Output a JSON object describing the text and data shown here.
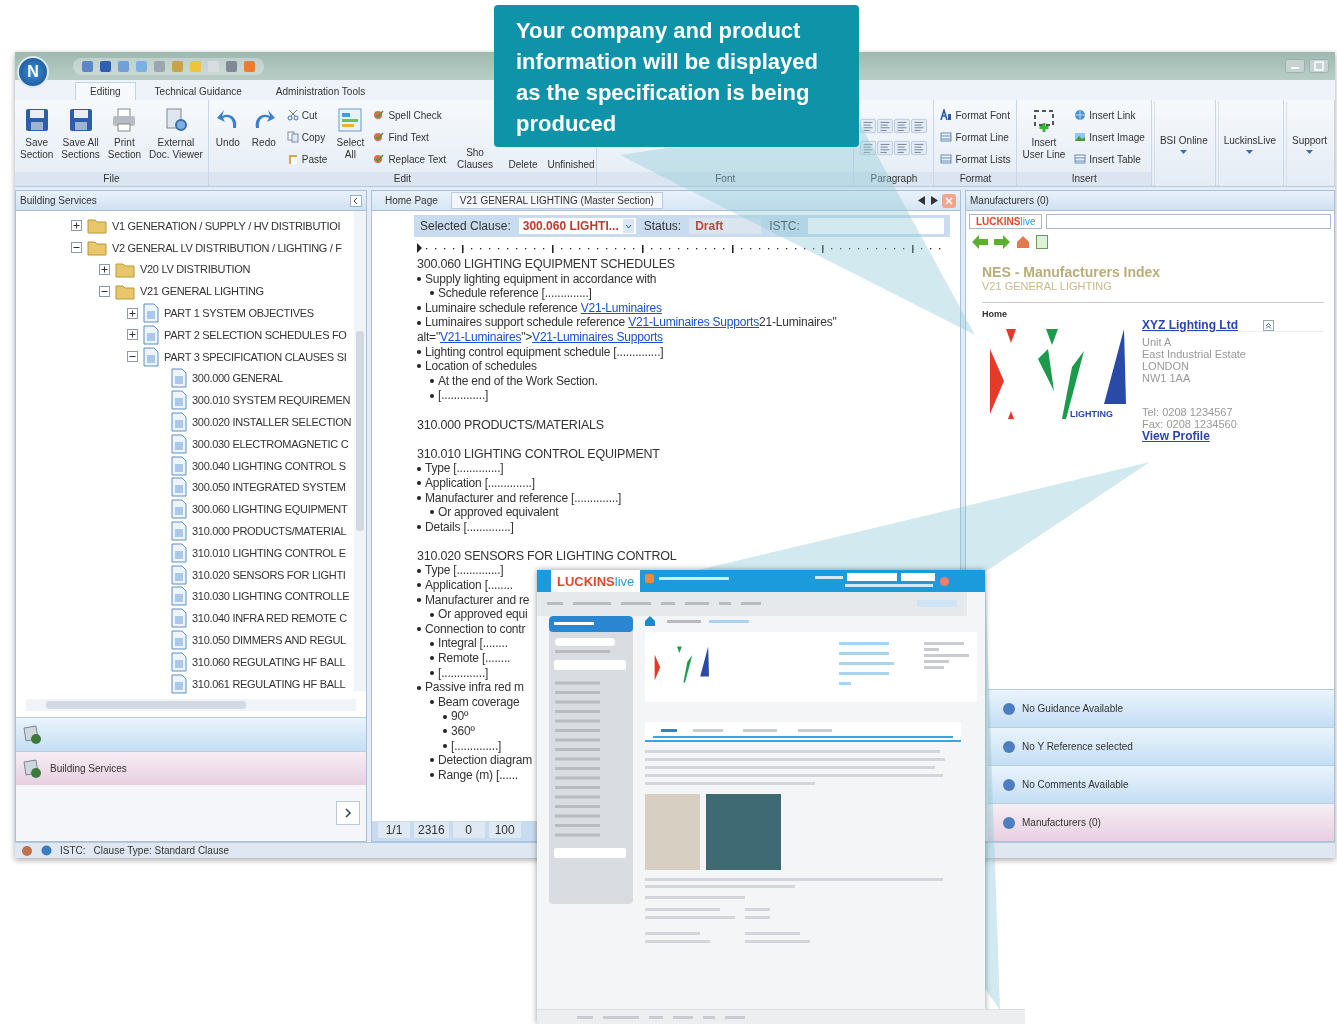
{
  "callout": {
    "text": "Your company and product information will be displayed as the specification is being produced"
  },
  "app": {
    "logo_letter": "N"
  },
  "ribbon_tabs": [
    {
      "label": "Editing",
      "selected": true
    },
    {
      "label": "Technical Guidance",
      "selected": false
    },
    {
      "label": "Administration Tools",
      "selected": false
    }
  ],
  "ribbon_groups": [
    {
      "title": "File",
      "items": [
        {
          "kind": "large",
          "lines": [
            "Save",
            "Section"
          ]
        },
        {
          "kind": "large",
          "lines": [
            "Save All",
            "Sections"
          ]
        },
        {
          "kind": "large",
          "lines": [
            "Print",
            "Section"
          ]
        },
        {
          "kind": "large",
          "lines": [
            "External",
            "Doc. Viewer"
          ]
        }
      ]
    },
    {
      "title": "Edit",
      "items": [
        {
          "kind": "large",
          "lines": [
            "Undo"
          ]
        },
        {
          "kind": "large",
          "lines": [
            "Redo"
          ]
        },
        {
          "kind": "stack",
          "items": [
            {
              "label": "Cut"
            },
            {
              "label": "Copy"
            },
            {
              "label": "Paste"
            }
          ]
        },
        {
          "kind": "large",
          "lines": [
            "Select",
            "All"
          ]
        },
        {
          "kind": "stack",
          "items": [
            {
              "label": "Spell Check"
            },
            {
              "label": "Find Text"
            },
            {
              "label": "Replace Text"
            }
          ]
        },
        {
          "kind": "hidden",
          "lines": [
            "Sho",
            "Clauses"
          ]
        },
        {
          "kind": "hidden",
          "lines": [
            "Delete"
          ]
        },
        {
          "kind": "hidden",
          "lines": [
            "Unfinished"
          ]
        }
      ]
    },
    {
      "title": "Font"
    },
    {
      "title": "Paragraph",
      "items": [
        {
          "kind": "align_grid"
        }
      ]
    },
    {
      "title": "Format",
      "items": [
        {
          "kind": "stack",
          "items": [
            {
              "label": "Format Font"
            },
            {
              "label": "Format Line"
            },
            {
              "label": "Format Lists"
            }
          ]
        }
      ]
    },
    {
      "title": "Insert",
      "items": [
        {
          "kind": "large",
          "lines": [
            "Insert",
            "User Line"
          ]
        },
        {
          "kind": "stack",
          "items": [
            {
              "label": "Insert Link"
            },
            {
              "label": "Insert Image"
            },
            {
              "label": "Insert Table"
            }
          ]
        }
      ]
    },
    {
      "items": [
        {
          "kind": "dropdown",
          "lines": [
            "BSI Online"
          ]
        }
      ]
    },
    {
      "items": [
        {
          "kind": "dropdown",
          "lines": [
            "LuckinsLive"
          ]
        }
      ]
    },
    {
      "items": [
        {
          "kind": "dropdown",
          "lines": [
            "Support"
          ]
        }
      ]
    }
  ],
  "left_panel": {
    "title": "Building Services",
    "tree": [
      {
        "kind": "folder",
        "label": "V1 GENERATION / SUPPLY / HV DISTRIBUTIOI",
        "expanded": false
      },
      {
        "kind": "folder",
        "label": "V2 GENERAL LV DISTRIBUTION / LIGHTING / F",
        "expanded": true,
        "children": [
          {
            "kind": "folder",
            "label": "V20 LV DISTRIBUTION",
            "expanded": false
          },
          {
            "kind": "folder",
            "label": "V21 GENERAL LIGHTING",
            "expanded": true,
            "children": [
              {
                "kind": "document",
                "label": "PART 1 SYSTEM OBJECTIVES",
                "expanded": false
              },
              {
                "kind": "document",
                "label": "PART 2 SELECTION SCHEDULES FO",
                "expanded": false
              },
              {
                "kind": "document",
                "label": "PART 3 SPECIFICATION CLAUSES SI",
                "expanded": true,
                "children": [
                  {
                    "kind": "clause",
                    "label": "300.000 GENERAL"
                  },
                  {
                    "kind": "clause",
                    "label": "300.010 SYSTEM REQUIREMEN"
                  },
                  {
                    "kind": "clause",
                    "label": "300.020 INSTALLER SELECTION"
                  },
                  {
                    "kind": "clause",
                    "label": "300.030 ELECTROMAGNETIC C"
                  },
                  {
                    "kind": "clause",
                    "label": "300.040 LIGHTING CONTROL S"
                  },
                  {
                    "kind": "clause",
                    "label": "300.050 INTEGRATED SYSTEM"
                  },
                  {
                    "kind": "clause",
                    "label": "300.060 LIGHTING EQUIPMENT"
                  },
                  {
                    "kind": "clause",
                    "label": "310.000 PRODUCTS/MATERIAL"
                  },
                  {
                    "kind": "clause",
                    "label": "310.010 LIGHTING CONTROL E"
                  },
                  {
                    "kind": "clause",
                    "label": "310.020 SENSORS FOR LIGHTI"
                  },
                  {
                    "kind": "clause",
                    "label": "310.030 LIGHTING CONTROLLE"
                  },
                  {
                    "kind": "clause",
                    "label": "310.040 INFRA RED REMOTE C"
                  },
                  {
                    "kind": "clause",
                    "label": "310.050 DIMMERS AND REGUL"
                  },
                  {
                    "kind": "clause",
                    "label": "310.060 REGULATING HF BALL"
                  },
                  {
                    "kind": "clause",
                    "label": "310.061 REGULATING HF BALL"
                  }
                ]
              }
            ]
          }
        ]
      }
    ],
    "nav_buttons": [
      {
        "selected": false
      },
      {
        "label": "Building Services",
        "selected": true
      }
    ]
  },
  "document": {
    "tabs": [
      {
        "label": "Home Page",
        "selected": false
      },
      {
        "label": "V21 GENERAL LIGHTING (Master Section)",
        "selected": true
      }
    ],
    "selected_clause_label": "Selected Clause:",
    "selected_clause": "300.060 LIGHTI...",
    "status_label": "Status:",
    "status": "Draft",
    "istc_label": "ISTC:",
    "lines": [
      {
        "kind": "heading",
        "text": "300.060 LIGHTING EQUIPMENT SCHEDULES"
      },
      {
        "kind": "bullet",
        "text": "Supply lighting equipment in accordance with"
      },
      {
        "kind": "sub_bullet",
        "text": "Schedule reference [..............]"
      },
      {
        "kind": "bullet",
        "segments": [
          {
            "kind": "text",
            "text": "Luminaire schedule reference "
          },
          {
            "kind": "link",
            "text": "V21-Luminaires"
          }
        ]
      },
      {
        "kind": "bullet",
        "segments": [
          {
            "kind": "text",
            "text": "Luminaires support schedule reference "
          },
          {
            "kind": "link",
            "text": "V21-Luminaires Supports"
          },
          {
            "kind": "text",
            "text": "21-Luminaires\""
          }
        ]
      },
      {
        "kind": "cont",
        "segments": [
          {
            "kind": "text",
            "text": "alt=\""
          },
          {
            "kind": "link",
            "text": "V21-Luminaires"
          },
          {
            "kind": "text",
            "text": "\">"
          },
          {
            "kind": "link",
            "text": "V21-Luminaires Supports"
          }
        ]
      },
      {
        "kind": "bullet",
        "text": "Lighting control equipment schedule [..............]"
      },
      {
        "kind": "bullet",
        "text": "Location of schedules"
      },
      {
        "kind": "sub_bullet",
        "text": "At the end of the Work Section."
      },
      {
        "kind": "sub_bullet",
        "text": "[..............]"
      },
      {
        "kind": "blank"
      },
      {
        "kind": "heading",
        "text": "310.000 PRODUCTS/MATERIALS"
      },
      {
        "kind": "blank"
      },
      {
        "kind": "heading",
        "text": "310.010 LIGHTING CONTROL EQUIPMENT"
      },
      {
        "kind": "bullet",
        "text": "Type [..............]"
      },
      {
        "kind": "bullet",
        "text": "Application [..............]"
      },
      {
        "kind": "bullet",
        "text": "Manufacturer and reference [..............]"
      },
      {
        "kind": "sub_bullet",
        "text": "Or approved equivalent"
      },
      {
        "kind": "bullet",
        "text": "Details [..............]"
      },
      {
        "kind": "blank"
      },
      {
        "kind": "heading",
        "text": "310.020 SENSORS FOR LIGHTING CONTROL"
      },
      {
        "kind": "bullet",
        "text": "Type [..............]"
      },
      {
        "kind": "bullet",
        "text": "Application [........"
      },
      {
        "kind": "bullet",
        "text": "Manufacturer and re"
      },
      {
        "kind": "sub_bullet",
        "text": "Or approved equi"
      },
      {
        "kind": "bullet",
        "text": "Connection to contr"
      },
      {
        "kind": "sub_bullet",
        "text": "Integral [........"
      },
      {
        "kind": "sub_bullet",
        "text": "Remote [........"
      },
      {
        "kind": "sub_bullet",
        "text": "[..............]"
      },
      {
        "kind": "bullet",
        "text": "Passive infra red m"
      },
      {
        "kind": "sub_bullet",
        "text": "Beam coverage"
      },
      {
        "kind": "sub_sub_bullet",
        "text": "90º"
      },
      {
        "kind": "sub_sub_bullet",
        "text": "360º"
      },
      {
        "kind": "sub_sub_bullet",
        "text": "[..............]"
      },
      {
        "kind": "sub_bullet",
        "text": "Detection diagram"
      },
      {
        "kind": "sub_bullet",
        "text": "Range (m) [......"
      }
    ],
    "status_fields": [
      "1/1",
      "2316",
      "0",
      "100"
    ]
  },
  "right_panel": {
    "title": "Manufacturers (0)",
    "logo_red": "LUCKINS",
    "logo_blue": "live",
    "index_title": "NES - Manufacturers Index",
    "index_subtitle": "V21 GENERAL LIGHTING",
    "breadcrumb": "Home",
    "logo_caption": "LIGHTING",
    "company": "XYZ Lighting Ltd",
    "address": [
      "Unit A",
      "East Industrial Estate",
      "LONDON",
      "NW1 1AA"
    ],
    "tel": "Tel: 0208 1234567",
    "fax": "Fax: 0208 1234560",
    "profile_link": "View Profile",
    "panes": [
      {
        "label": "No Guidance Available",
        "selected": false
      },
      {
        "label": "No Y Reference selected",
        "selected": false
      },
      {
        "label": "No Comments Available",
        "selected": false
      },
      {
        "label": "Manufacturers (0)",
        "selected": true
      }
    ]
  },
  "status_bar": {
    "istc": "ISTC:",
    "clause_type": "Clause Type: Standard Clause"
  },
  "website": {
    "logo_red": "LUCKINS",
    "logo_blue": "live"
  }
}
